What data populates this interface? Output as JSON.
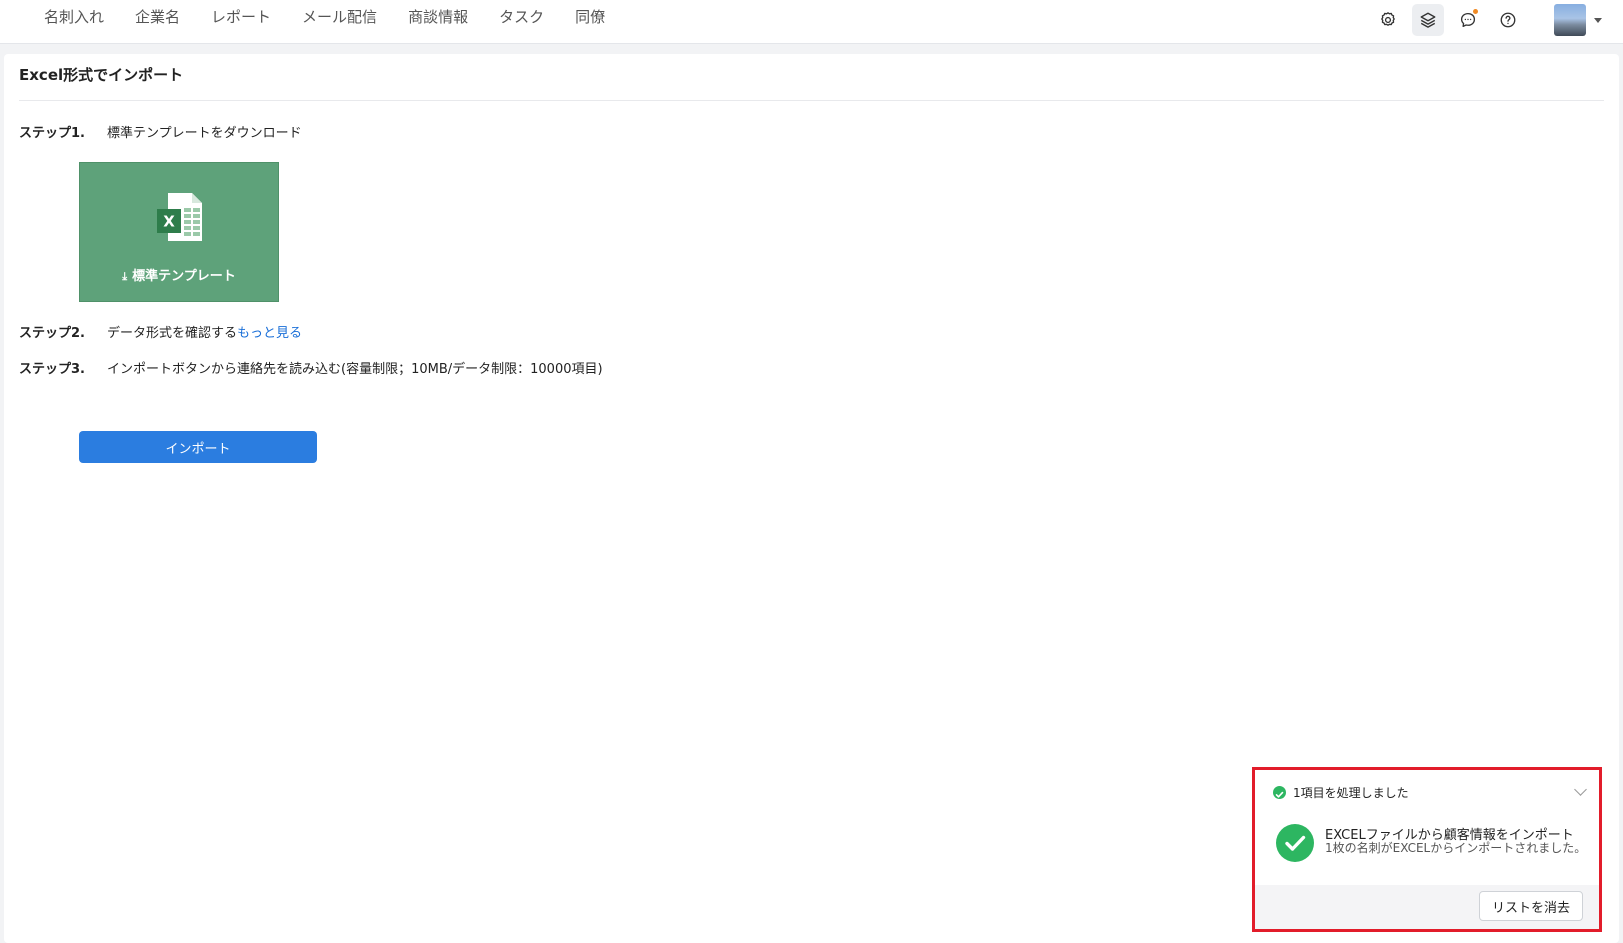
{
  "nav": {
    "items": [
      "名刺入れ",
      "企業名",
      "レポート",
      "メール配信",
      "商談情報",
      "タスク",
      "同僚"
    ]
  },
  "icons": {
    "settings": "gear-icon",
    "layers": "layers-icon",
    "chat": "chat-icon",
    "help": "help-icon"
  },
  "colors": {
    "template_card": "#5ea27a",
    "import_button": "#2b7de0",
    "success": "#2db661",
    "link": "#1a6fd8",
    "notification_dot": "#f08a24",
    "highlight_border": "#e21c2a"
  },
  "page": {
    "title": "Excel形式でインポート"
  },
  "steps": [
    {
      "label": "ステップ1.",
      "text": "標準テンプレートをダウンロード"
    },
    {
      "label": "ステップ2.",
      "text": "データ形式を確認する",
      "link": "もっと見る"
    },
    {
      "label": "ステップ3.",
      "text": "インポートボタンから連絡先を読み込む(容量制限；10MB/データ制限：10000項目)"
    }
  ],
  "template_card": {
    "icon_letter": "X",
    "label": "標準テンプレート"
  },
  "import_button": {
    "label": "インポート"
  },
  "toast": {
    "header": "1項目を処理しました",
    "title": "EXCELファイルから顧客情報をインポート",
    "description": "1枚の名刺がEXCELからインポートされました。",
    "clear_button": "リストを消去"
  }
}
